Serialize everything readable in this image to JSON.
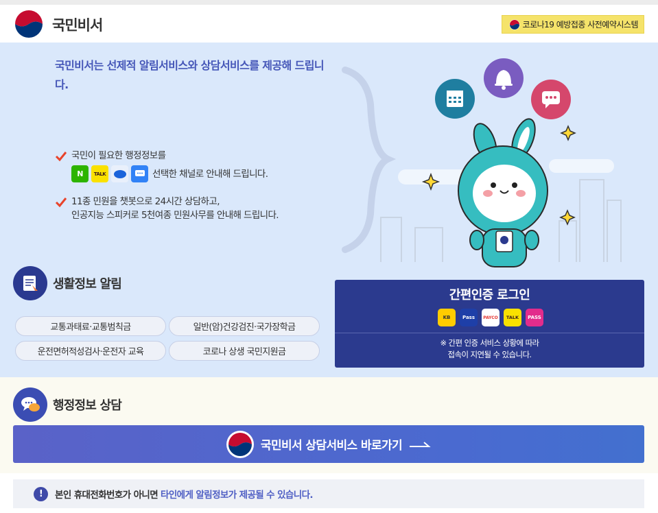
{
  "header": {
    "brand": "국민비서",
    "covid_button": "코로나19 예방접종 사전예약시스템"
  },
  "hero": {
    "intro": "국민비서는 선제적 알림서비스와 상담서비스를 제공해 드립니다.",
    "point1_line1": "국민이 필요한 행정정보를",
    "point1_line2": "선택한 채널로 안내해 드립니다.",
    "point2_line1": "11종 민원을 챗봇으로 24시간 상담하고,",
    "point2_line2": "인공지능 스피커로 5천여종 민원사무를 안내해 드립니다.",
    "channels": [
      "N",
      "TALK",
      "",
      ""
    ]
  },
  "life_info": {
    "title": "생활정보 알림",
    "items": [
      "교통과태료·교통범칙금",
      "일반(암)건강검진·국가장학금",
      "운전면허적성검사·운전자 교육",
      "코로나 상생 국민지원금"
    ]
  },
  "login": {
    "title": "간편인증 로그인",
    "providers": [
      "KB",
      "Pass",
      "PAYCO",
      "TALK",
      "PASS"
    ],
    "note_line1": "※ 간편 인증 서비스 상황에 따라",
    "note_line2": "접속이 지연될 수 있습니다."
  },
  "consult": {
    "title": "행정정보 상담",
    "button": "국민비서 상담서비스 바로가기"
  },
  "notice": {
    "part1": "본인 휴대전화번호가 아니면",
    "part2": "타인에게 알림정보가 제공될 수 있습니다."
  },
  "colors": {
    "hero_bg": "#dae8fb",
    "accent_blue": "#4556b8",
    "navy": "#2b3a8e",
    "covid_yellow": "#f5e36a"
  }
}
